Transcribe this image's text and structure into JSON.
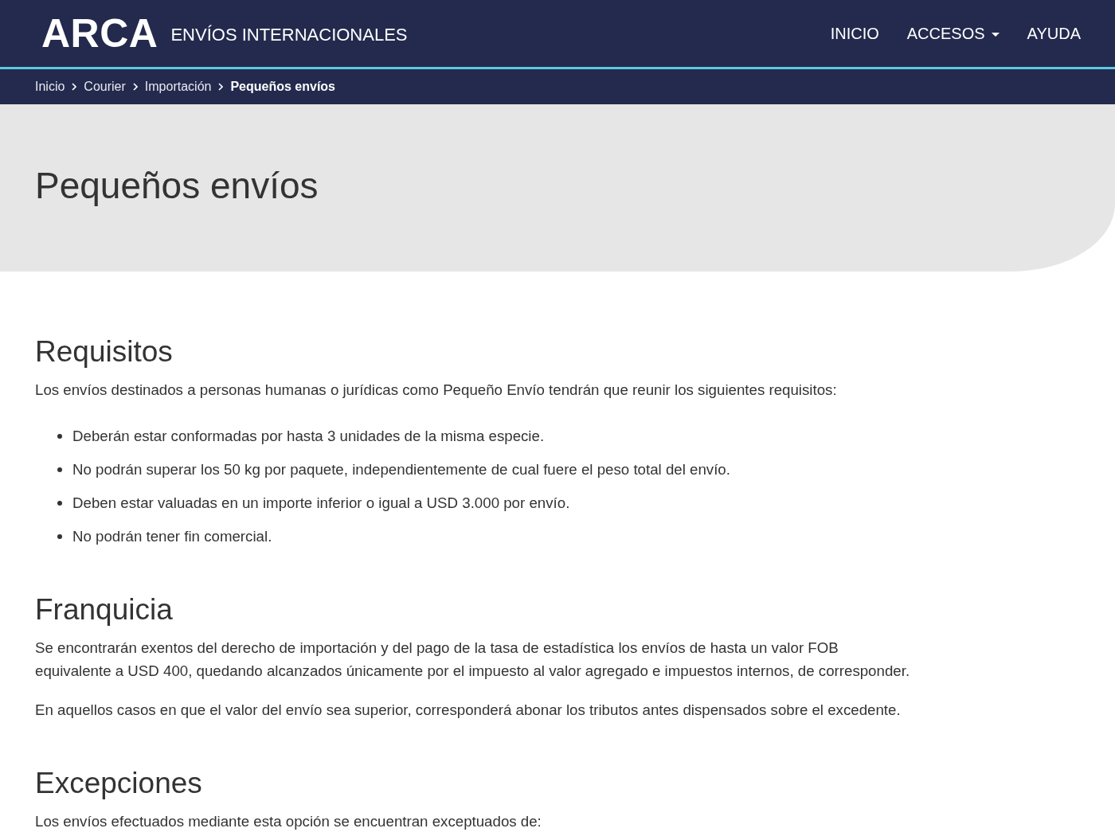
{
  "header": {
    "logo": "ARCA",
    "site_title": "ENVÍOS INTERNACIONALES",
    "nav": [
      {
        "label": "INICIO",
        "dropdown": false
      },
      {
        "label": "ACCESOS",
        "dropdown": true
      },
      {
        "label": "AYUDA",
        "dropdown": false
      }
    ]
  },
  "breadcrumb": [
    {
      "label": "Inicio",
      "current": false
    },
    {
      "label": "Courier",
      "current": false
    },
    {
      "label": "Importación",
      "current": false
    },
    {
      "label": "Pequeños envíos",
      "current": true
    }
  ],
  "hero": {
    "title": "Pequeños envíos"
  },
  "sections": [
    {
      "heading": "Requisitos",
      "blocks": [
        {
          "kind": "paragraph",
          "text": "Los envíos destinados a personas humanas o jurídicas como Pequeño Envío tendrán que reunir los siguientes requisitos:"
        },
        {
          "kind": "list",
          "items": [
            "Deberán estar conformadas por hasta 3 unidades de la misma especie.",
            "No podrán superar los 50 kg por paquete, independientemente de cual fuere el peso total del envío.",
            "Deben estar valuadas en un importe inferior o igual a USD 3.000 por envío.",
            "No podrán tener fin comercial."
          ]
        }
      ]
    },
    {
      "heading": "Franquicia",
      "blocks": [
        {
          "kind": "paragraph",
          "text": "Se encontrarán exentos del derecho de importación y del pago de la tasa de estadística los envíos de hasta un valor FOB equivalente a USD 400, quedando alcanzados únicamente por el impuesto al valor agregado e impuestos internos, de corresponder."
        },
        {
          "kind": "paragraph",
          "text": "En aquellos casos en que el valor del envío sea superior, corresponderá abonar los tributos antes dispensados sobre el excedente."
        }
      ]
    },
    {
      "heading": "Excepciones",
      "blocks": [
        {
          "kind": "paragraph",
          "text": "Los envíos efectuados mediante esta opción se encuentran exceptuados de:"
        }
      ]
    }
  ]
}
